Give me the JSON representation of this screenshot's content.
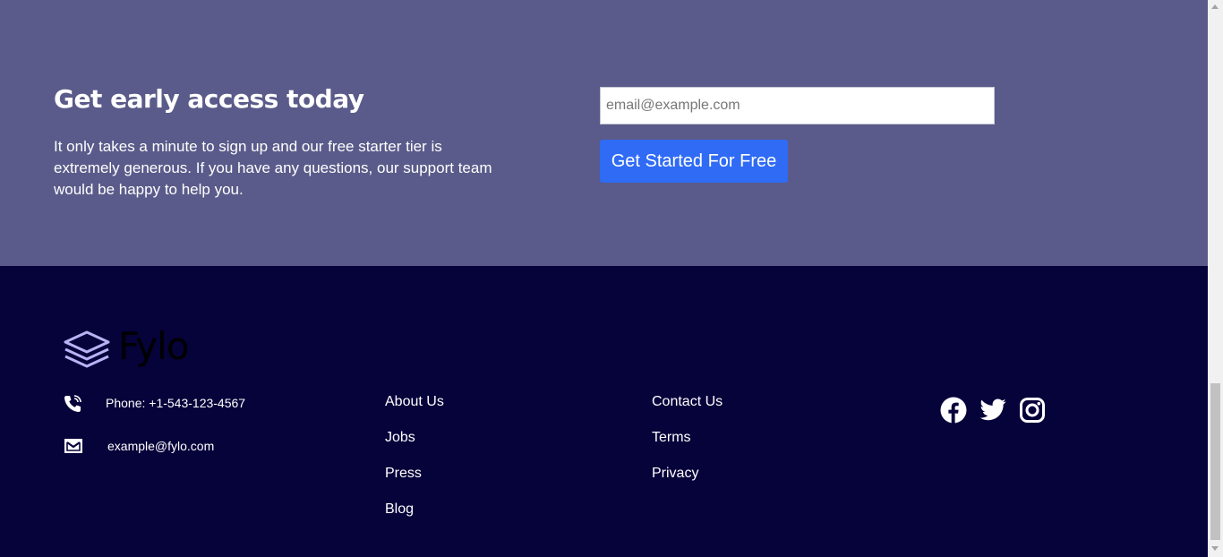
{
  "cta": {
    "heading": "Get early access today",
    "body": "It only takes a minute to sign up and our free starter tier is extremely generous. If you have any questions, our support team would be happy to help you.",
    "email_placeholder": "email@example.com",
    "email_value": "",
    "button_label": "Get Started For Free"
  },
  "footer": {
    "logo_text": "Fylo",
    "phone": "Phone: +1-543-123-4567",
    "email": "example@fylo.com",
    "links_col1": [
      "About Us",
      "Jobs",
      "Press",
      "Blog"
    ],
    "links_col2": [
      "Contact Us",
      "Terms",
      "Privacy"
    ],
    "social_icons": [
      "facebook-icon",
      "twitter-icon",
      "instagram-icon"
    ]
  },
  "colors": {
    "cta_background": "#5a5b8a",
    "footer_background": "#06023a",
    "button": "#2f6bf5",
    "logo_accent": "#b8b3f5"
  }
}
